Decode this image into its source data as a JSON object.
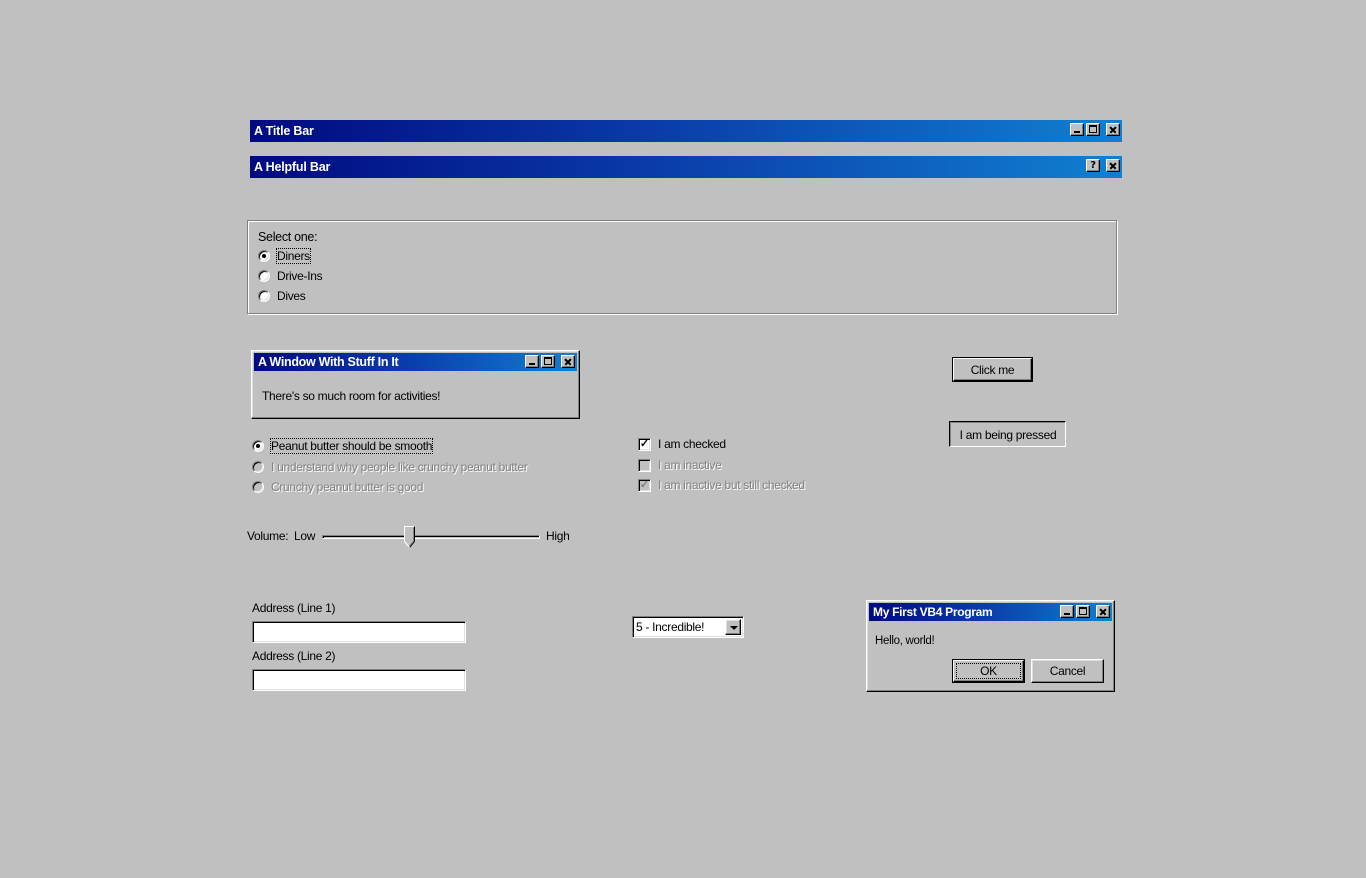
{
  "title_bar": {
    "title": "A Title Bar"
  },
  "helpful_bar": {
    "title": "A Helpful Bar",
    "help_glyph": "?"
  },
  "select_group": {
    "label": "Select one:",
    "options": [
      "Diners",
      "Drive-Ins",
      "Dives"
    ],
    "selected": "Diners"
  },
  "stuff_window": {
    "title": "A Window With Stuff In It",
    "body": "There's so much room for activities!"
  },
  "peanut_radios": {
    "options": [
      {
        "label": "Peanut butter should be smooth",
        "checked": true,
        "disabled": false
      },
      {
        "label": "I understand why people like crunchy peanut butter",
        "checked": false,
        "disabled": true
      },
      {
        "label": "Crunchy peanut butter is good",
        "checked": false,
        "disabled": true
      }
    ]
  },
  "checkboxes": {
    "items": [
      {
        "label": "I am checked",
        "checked": true,
        "disabled": false
      },
      {
        "label": "I am inactive",
        "checked": false,
        "disabled": true
      },
      {
        "label": "I am inactive but still checked",
        "checked": true,
        "disabled": true
      }
    ],
    "check_glyph": "✓"
  },
  "buttons": {
    "click_me": "Click me",
    "pressed": "I am being pressed"
  },
  "volume": {
    "label": "Volume:",
    "low": "Low",
    "high": "High",
    "value": 0.4
  },
  "address": {
    "line1_label": "Address (Line 1)",
    "line1_value": "",
    "line2_label": "Address (Line 2)",
    "line2_value": ""
  },
  "rating_select": {
    "value": "5 - Incredible!"
  },
  "vb_dialog": {
    "title": "My First VB4 Program",
    "message": "Hello, world!",
    "ok": "OK",
    "cancel": "Cancel"
  },
  "colors": {
    "desktop": "#c0c0c0",
    "title_start": "#000a80",
    "title_end": "#1080d0"
  },
  "icons": [
    "minimize-icon",
    "maximize-icon",
    "close-icon",
    "help-icon",
    "dropdown-arrow-icon",
    "slider-thumb-icon"
  ]
}
